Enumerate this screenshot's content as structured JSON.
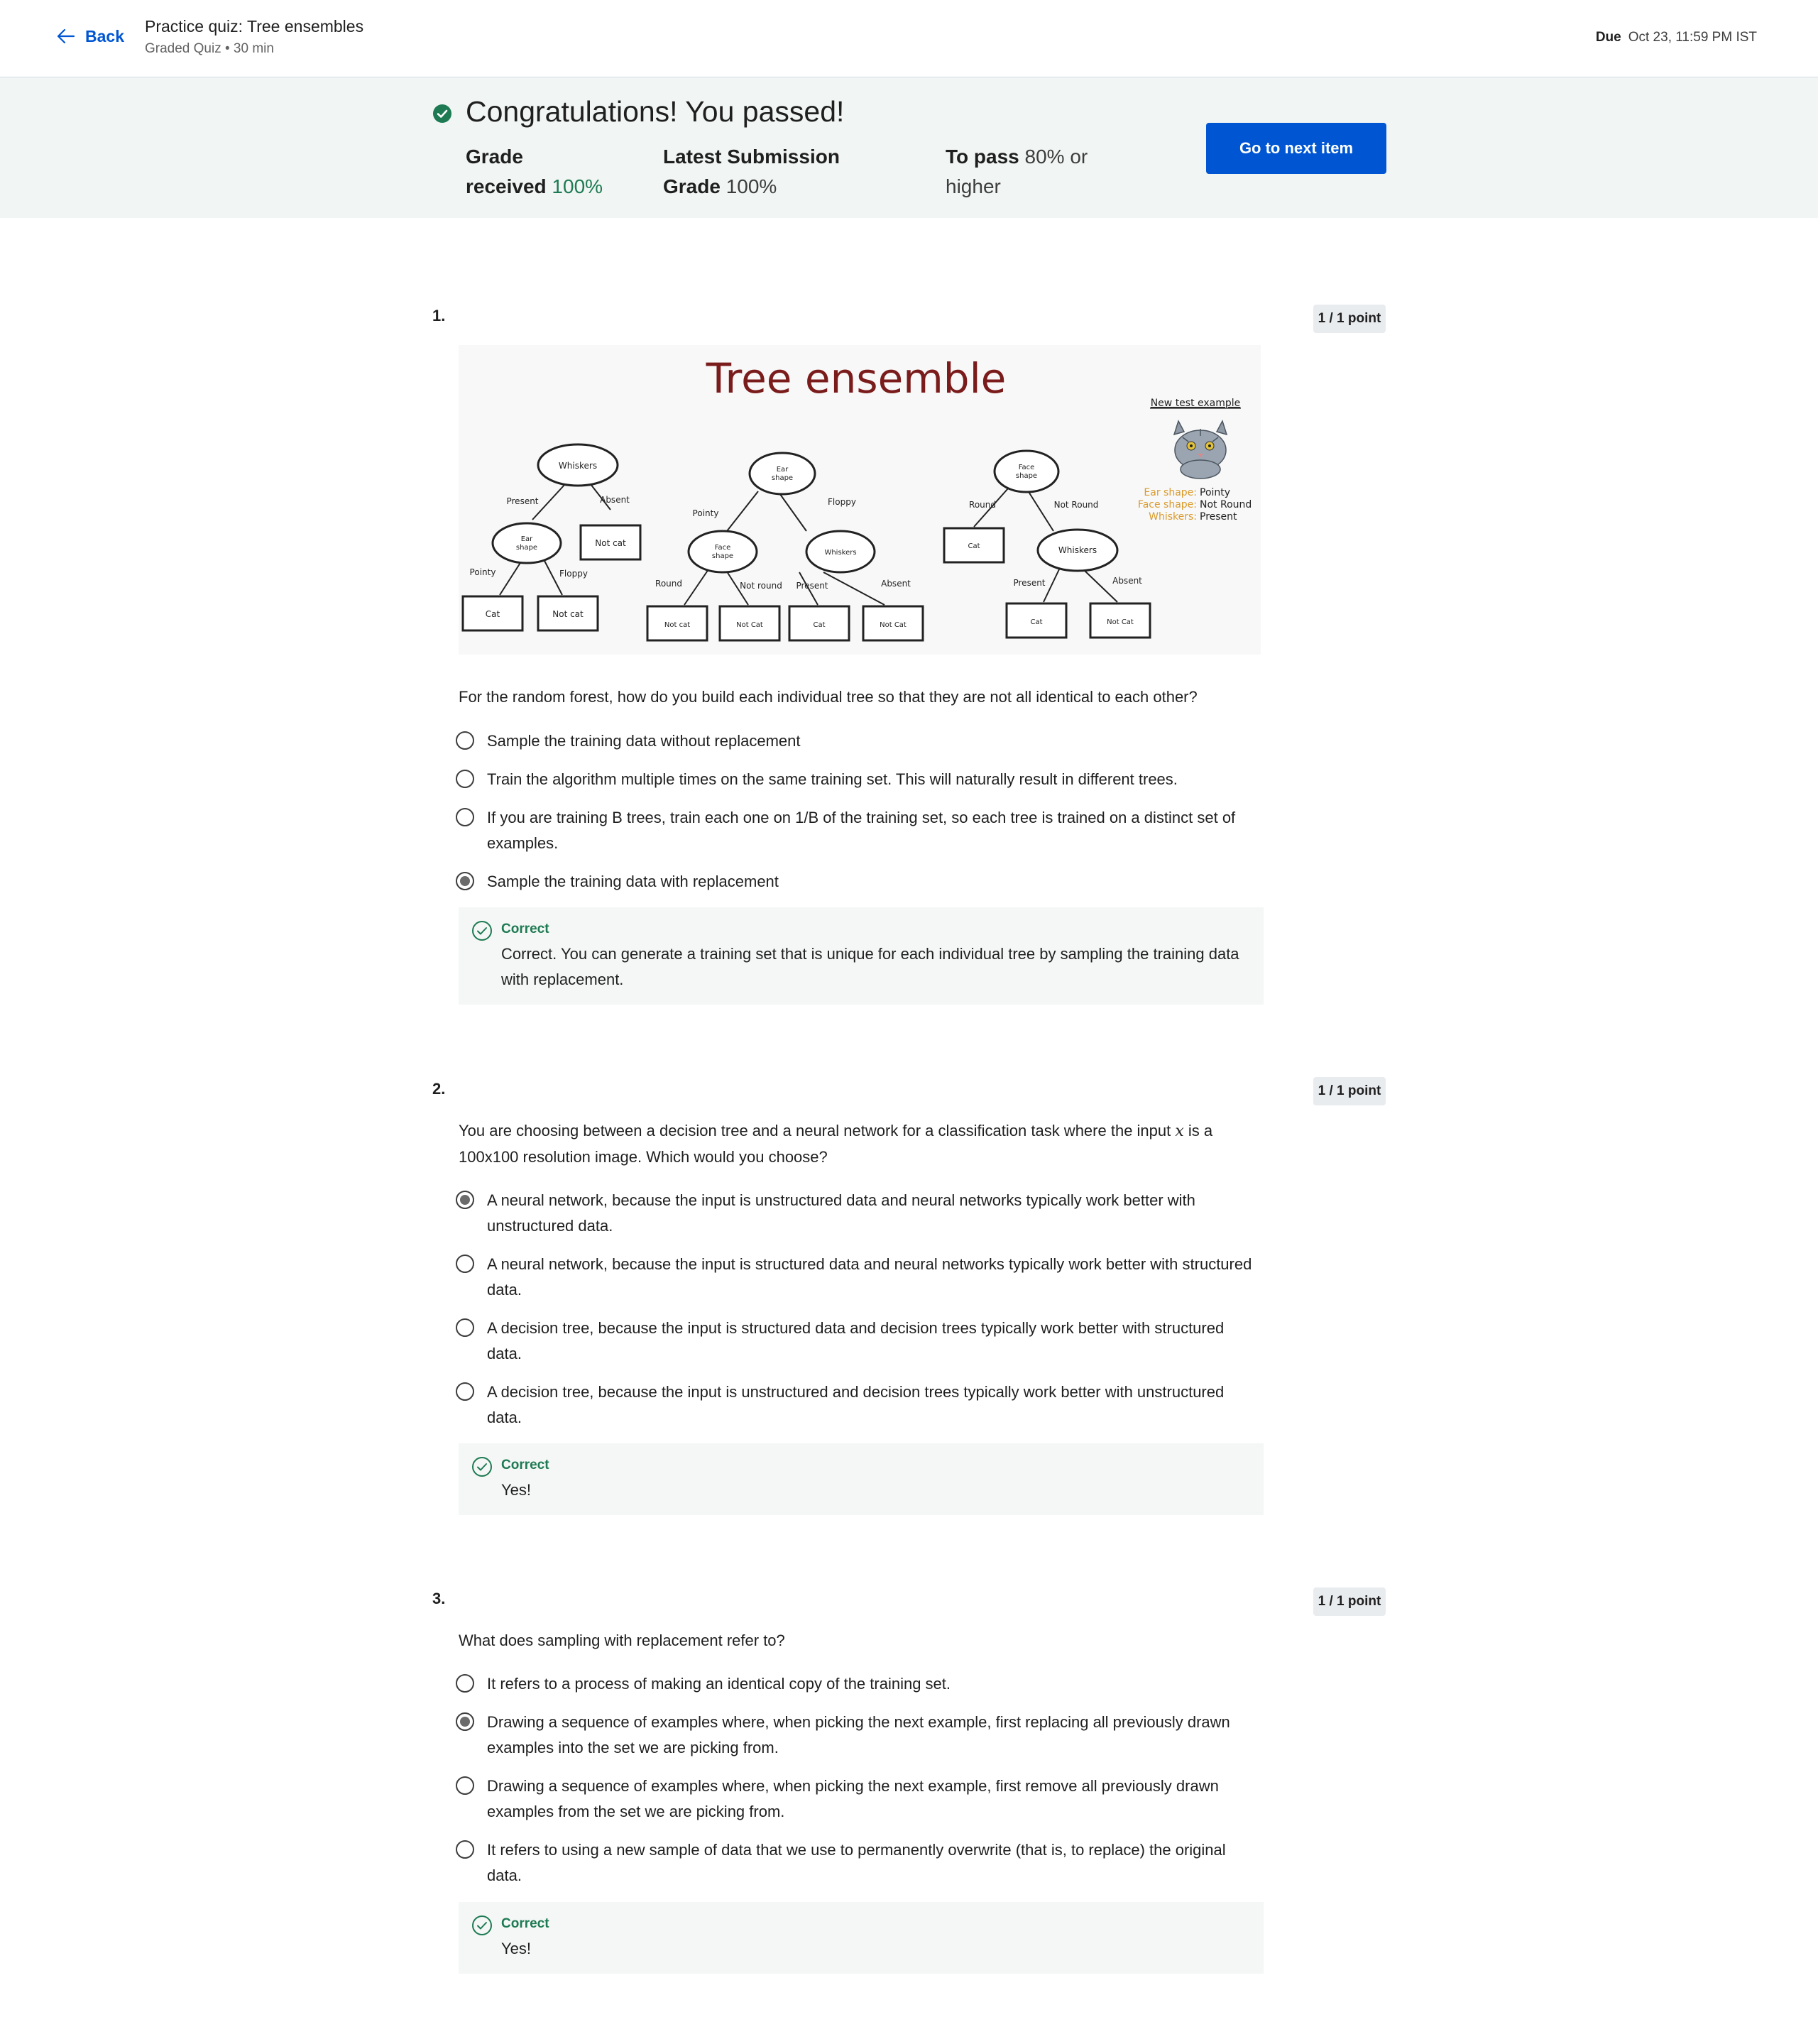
{
  "header": {
    "back_label": "Back",
    "quiz_title": "Practice quiz: Tree ensembles",
    "quiz_meta": "Graded Quiz • 30 min",
    "due_label": "Due",
    "due_value": "Oct 23, 11:59 PM IST"
  },
  "result": {
    "headline": "Congratulations! You passed!",
    "grade_label_1": "Grade",
    "grade_label_2": "received",
    "grade_value": "100%",
    "latest_label_1": "Latest Submission",
    "latest_label_2": "Grade",
    "latest_value": "100%",
    "pass_label": "To pass",
    "pass_value_1": "80% or",
    "pass_value_2": "higher",
    "next_button": "Go to next item"
  },
  "figure": {
    "title": "Tree ensemble",
    "new_example_label": "New test example",
    "attr_1_key": "Ear shape:",
    "attr_1_val": "Pointy",
    "attr_2_key": "Face shape:",
    "attr_2_val": "Not Round",
    "attr_3_key": "Whiskers:",
    "attr_3_val": "Present",
    "tree1": {
      "root": "Whiskers",
      "edge_l": "Present",
      "edge_r": "Absent",
      "right_leaf": "Not cat",
      "child_l1": "Ear",
      "child_l2": "shape",
      "child_edge_l": "Pointy",
      "child_edge_r": "Floppy",
      "leaf_1": "Cat",
      "leaf_2": "Not cat"
    },
    "tree2": {
      "root_1": "Ear",
      "root_2": "shape",
      "edge_l": "Pointy",
      "edge_r": "Floppy",
      "left_1": "Face",
      "left_2": "shape",
      "right": "Whiskers",
      "ll_edge": "Round",
      "lr_edge": "Not round",
      "rl_edge": "Present",
      "rr_edge": "Absent",
      "leaf_1": "Not cat",
      "leaf_2": "Not Cat",
      "leaf_3": "Cat",
      "leaf_4": "Not Cat"
    },
    "tree3": {
      "root_1": "Face",
      "root_2": "shape",
      "edge_l": "Round",
      "edge_r": "Not Round",
      "left_leaf": "Cat",
      "right": "Whiskers",
      "rl_edge": "Present",
      "rr_edge": "Absent",
      "leaf_1": "Cat",
      "leaf_2": "Not Cat"
    }
  },
  "questions": [
    {
      "number": "1.",
      "points": "1 / 1 point",
      "prompt": "For the random forest, how do you build each individual tree so that they are not all identical to each other?",
      "options": [
        {
          "label": "Sample the training data without replacement",
          "selected": false
        },
        {
          "label": "Train the algorithm multiple times on the same training set. This will naturally result in different trees.",
          "selected": false
        },
        {
          "label": "If you are training B trees, train each one on 1/B of the training set, so each tree is trained on a distinct set of examples.",
          "selected": false
        },
        {
          "label": "Sample the training data with replacement",
          "selected": true
        }
      ],
      "feedback_title": "Correct",
      "feedback_text": "Correct. You can generate a training set that is unique for each individual tree by sampling the training data with replacement."
    },
    {
      "number": "2.",
      "points": "1 / 1 point",
      "prompt_before": "You are choosing between a decision tree and a neural network for a classification task where the input ",
      "prompt_var": "x",
      "prompt_after": " is a 100x100 resolution image. Which would you choose?",
      "options": [
        {
          "label": "A neural network, because the input is unstructured data and neural networks typically work better with unstructured data.",
          "selected": true
        },
        {
          "label": "A neural network, because the input is structured data and neural networks typically work better with structured data.",
          "selected": false
        },
        {
          "label": "A decision tree, because the input is structured data and decision trees typically work better with structured data.",
          "selected": false
        },
        {
          "label": "A decision tree, because the input is unstructured and decision trees typically work better with unstructured data.",
          "selected": false
        }
      ],
      "feedback_title": "Correct",
      "feedback_text": "Yes!"
    },
    {
      "number": "3.",
      "points": "1 / 1 point",
      "prompt": "What does sampling with replacement refer to?",
      "options": [
        {
          "label": "It refers to a process of making an identical copy of the training set.",
          "selected": false
        },
        {
          "label": "Drawing a sequence of examples where, when picking the next example, first replacing all previously drawn examples into the set we are picking from.",
          "selected": true
        },
        {
          "label": "Drawing a sequence of examples where, when picking the next example, first remove all previously drawn examples from the set we are picking from.",
          "selected": false
        },
        {
          "label": "It refers to using a new sample of data that we use to permanently overwrite (that is, to replace) the original data.",
          "selected": false
        }
      ],
      "feedback_title": "Correct",
      "feedback_text": "Yes!"
    }
  ],
  "colors": {
    "brand_blue": "#0056d2",
    "success_green": "#1e7a52",
    "banner_bg": "#f1f5f4",
    "figure_title": "#7b1c1c",
    "attr_key_orange": "#d99a2b"
  },
  "icons": [
    "arrow-left-icon",
    "check-circle-filled-icon",
    "check-circle-outline-icon",
    "cat-icon"
  ]
}
